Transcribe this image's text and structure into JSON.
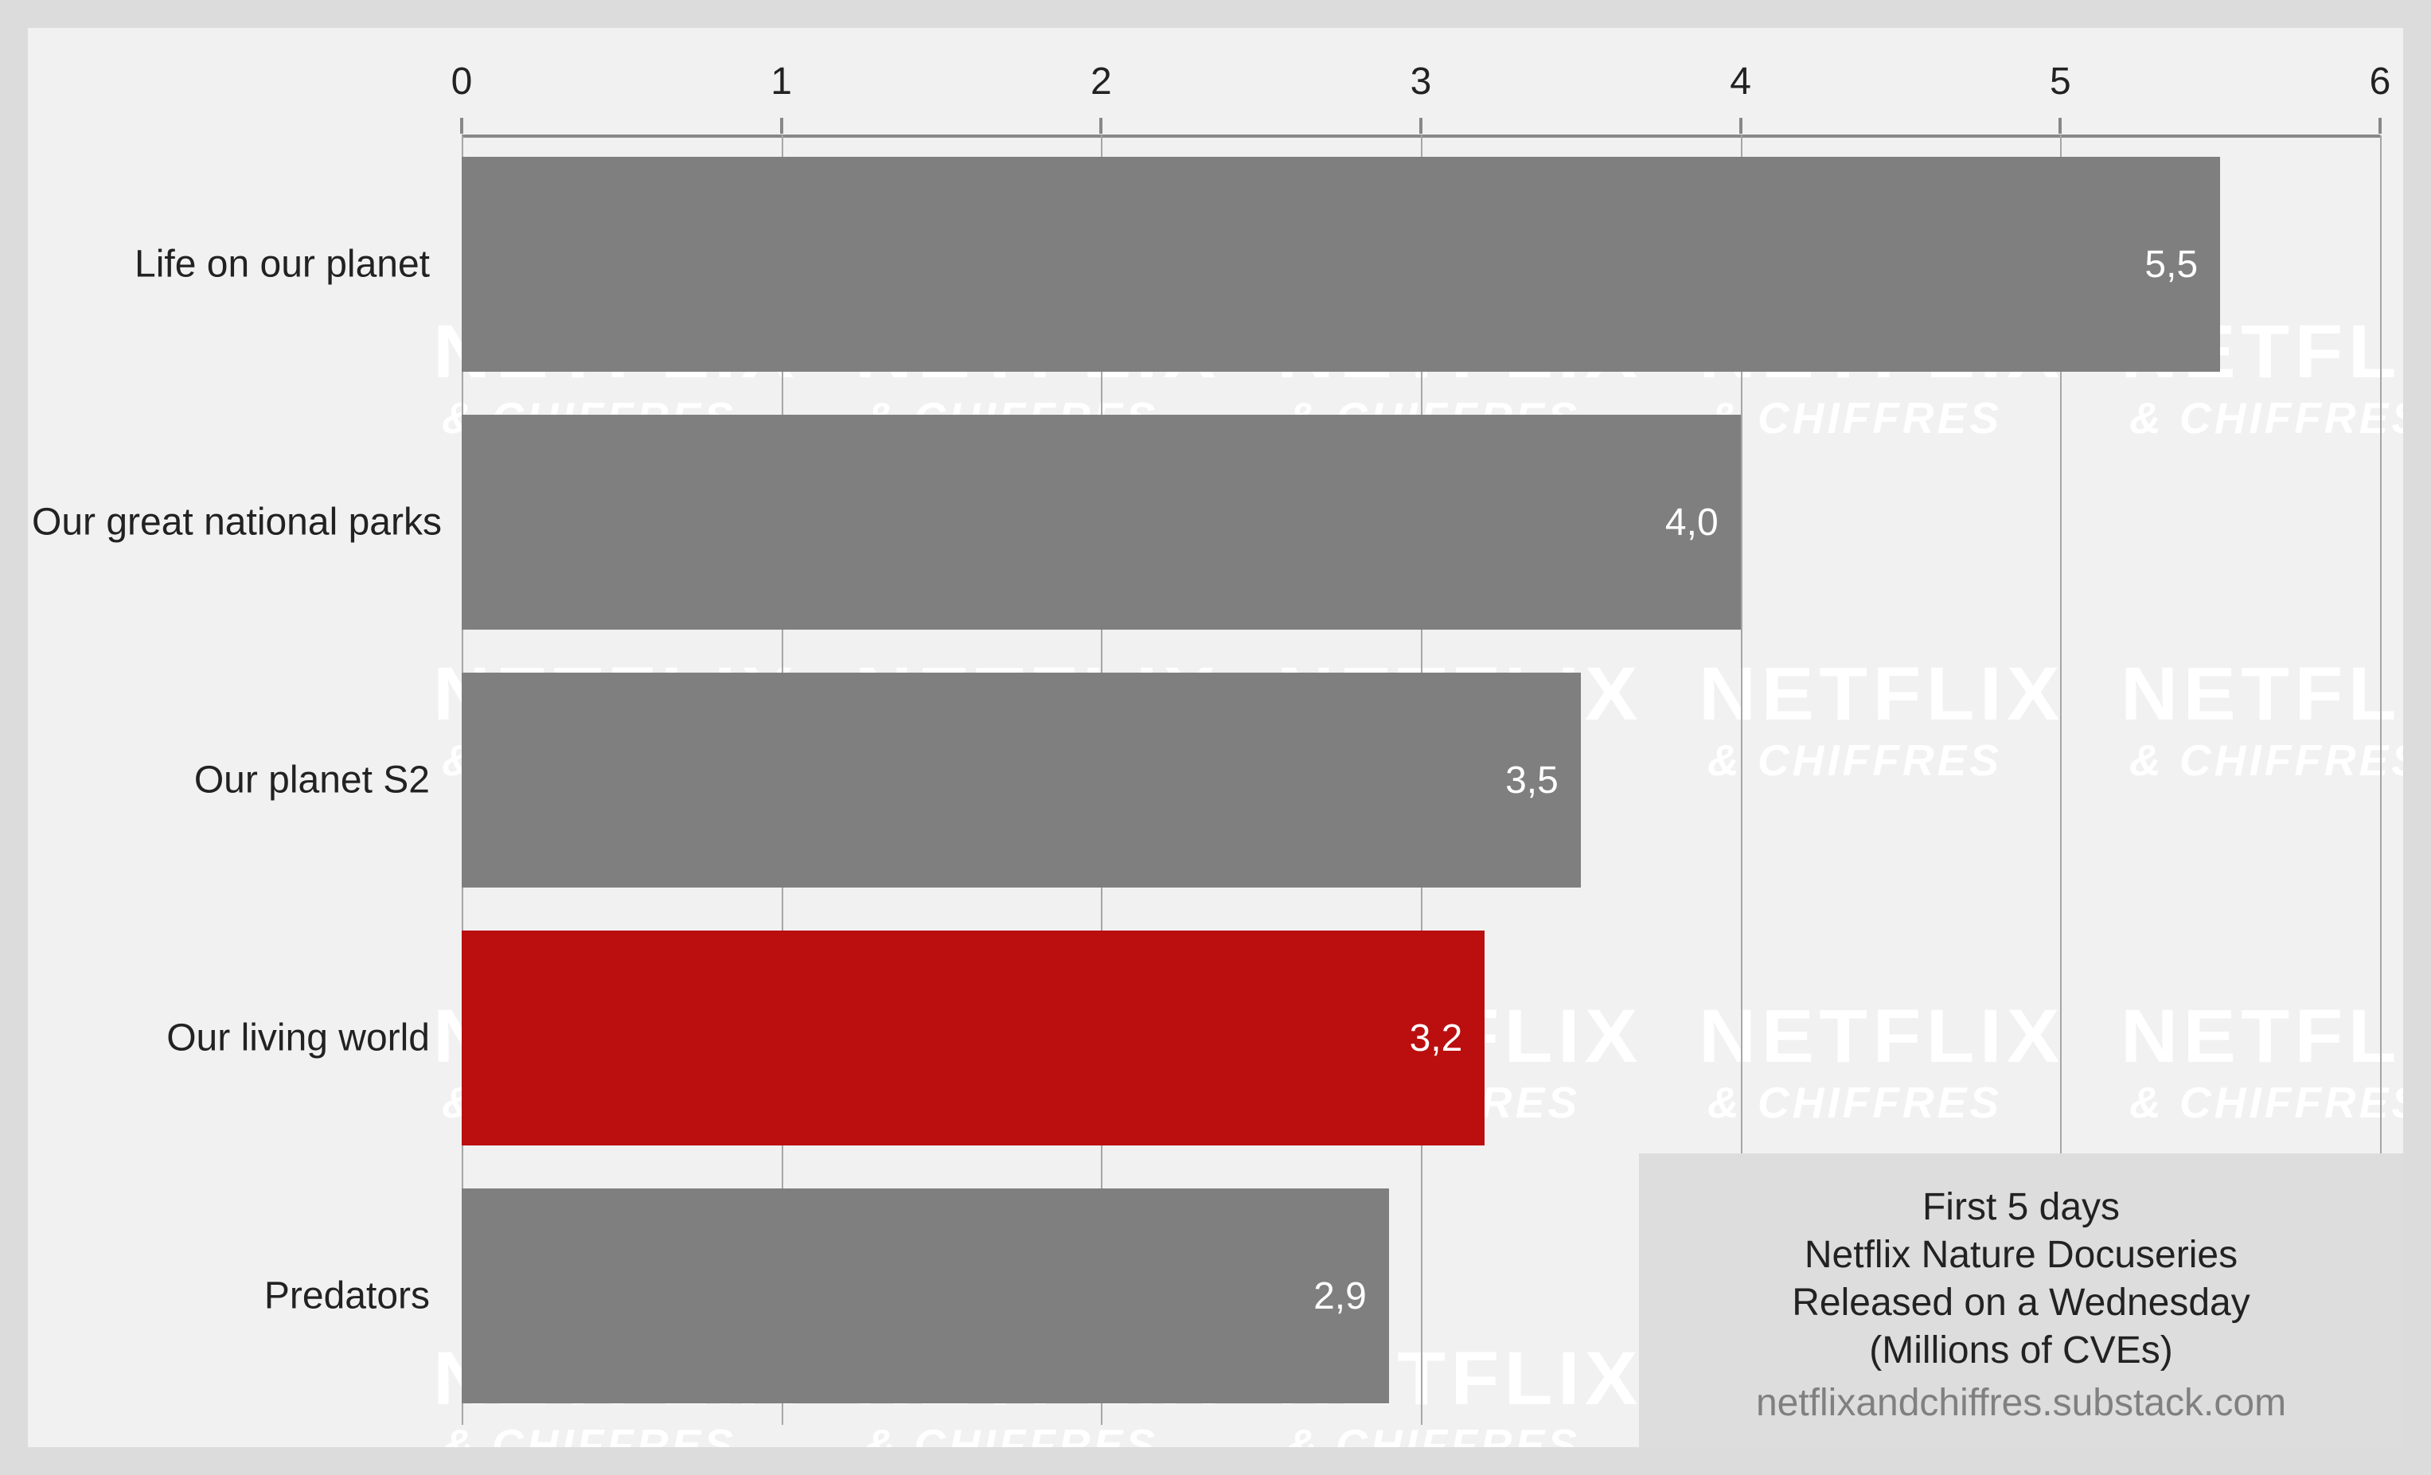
{
  "chart_data": {
    "type": "bar",
    "orientation": "horizontal",
    "xlim": [
      0,
      6
    ],
    "xticks": [
      0,
      1,
      2,
      3,
      4,
      5,
      6
    ],
    "categories": [
      "Life on our planet",
      "Our great national parks",
      "Our planet S2",
      "Our living world",
      "Predators"
    ],
    "values": [
      5.5,
      4.0,
      3.5,
      3.2,
      2.9
    ],
    "labels": [
      "5,5",
      "4,0",
      "3,5",
      "3,2",
      "2,9"
    ],
    "highlighted_index": 3,
    "colors": {
      "default": "#7f7f7f",
      "highlight": "#bb0e0e"
    },
    "annotation": {
      "lines": [
        "First 5 days",
        "Netflix Nature Docuseries",
        "Released on a Wednesday",
        "(Millions of CVEs)"
      ],
      "source": "netflixandchiffres.substack.com"
    },
    "watermark": {
      "top": "NETFLIX",
      "bottom": "& CHIFFRES"
    }
  }
}
